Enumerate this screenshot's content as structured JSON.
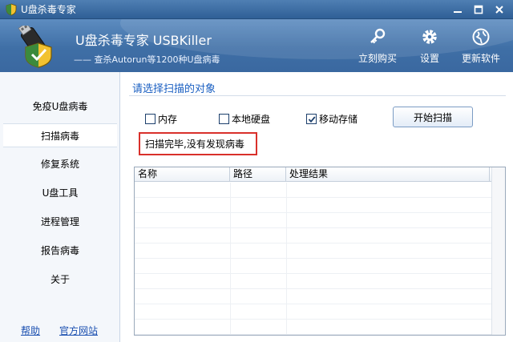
{
  "window": {
    "title": "U盘杀毒专家",
    "controls": [
      "minimize",
      "maximize",
      "close"
    ]
  },
  "header": {
    "app_name": "U盘杀毒专家  USBKiller",
    "subtitle": "—— 查杀Autorun等1200种U盘病毒",
    "buttons": [
      {
        "label": "立刻购买",
        "icon": "key-icon"
      },
      {
        "label": "设置",
        "icon": "gear-icon"
      },
      {
        "label": "更新软件",
        "icon": "globe-icon"
      }
    ]
  },
  "sidebar": {
    "items": [
      {
        "label": "免疫U盘病毒",
        "active": false
      },
      {
        "label": "扫描病毒",
        "active": true
      },
      {
        "label": "修复系统",
        "active": false
      },
      {
        "label": "U盘工具",
        "active": false
      },
      {
        "label": "进程管理",
        "active": false
      },
      {
        "label": "报告病毒",
        "active": false
      },
      {
        "label": "关于",
        "active": false
      }
    ],
    "links": {
      "help": "帮助",
      "website": "官方网站"
    }
  },
  "main": {
    "section_title": "请选择扫描的对象",
    "options": [
      {
        "label": "内存",
        "checked": false
      },
      {
        "label": "本地硬盘",
        "checked": false
      },
      {
        "label": "移动存储",
        "checked": true
      }
    ],
    "scan_button": "开始扫描",
    "status": "扫描完毕,没有发现病毒",
    "table": {
      "columns": [
        "名称",
        "路径",
        "处理结果"
      ],
      "rows": []
    }
  },
  "colors": {
    "title_bar": "#3a6aa0",
    "header": "#4a7ab2",
    "section_title": "#1a5fc2",
    "status_border": "#d9302b",
    "link": "#1a4fb0"
  }
}
